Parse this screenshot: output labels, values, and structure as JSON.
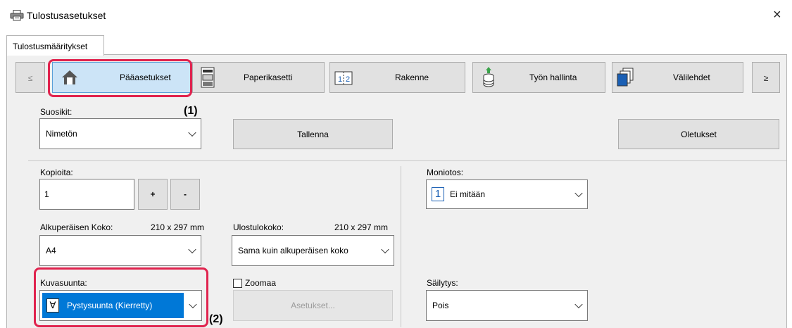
{
  "window": {
    "title": "Tulostusasetukset",
    "close_glyph": "×"
  },
  "tab": {
    "label": "Tulostusmääritykset"
  },
  "nav": {
    "prev_label": "≤",
    "next_label": "≥",
    "items": [
      {
        "label": "Pääasetukset",
        "icon": "home-icon"
      },
      {
        "label": "Paperikasetti",
        "icon": "paper-tray-icon"
      },
      {
        "label": "Rakenne",
        "icon": "layout-icon"
      },
      {
        "label": "Työn hallinta",
        "icon": "job-storage-icon"
      },
      {
        "label": "Välilehdet",
        "icon": "tab-pages-icon"
      }
    ]
  },
  "callouts": {
    "one": "(1)",
    "two": "(2)"
  },
  "favorites": {
    "label": "Suosikit:",
    "value": "Nimetön",
    "save_label": "Tallenna",
    "defaults_label": "Oletukset"
  },
  "copies": {
    "label": "Kopioita:",
    "value": "1",
    "plus_label": "+",
    "minus_label": "-"
  },
  "original_size": {
    "label": "Alkuperäisen Koko:",
    "dimensions": "210 x 297 mm",
    "value": "A4"
  },
  "output_size": {
    "label": "Ulostulokoko:",
    "dimensions": "210 x 297 mm",
    "value": "Sama kuin alkuperäisen koko"
  },
  "orientation": {
    "label": "Kuvasuunta:",
    "value": "Pystysuunta (Kierretty)",
    "icon_glyph": "∀"
  },
  "zoom": {
    "label": "Zoomaa",
    "settings_label": "Asetukset..."
  },
  "nup": {
    "label": "Moniotos:",
    "value": "Ei mitään",
    "icon_glyph": "1"
  },
  "retention": {
    "label": "Säilytys:",
    "value": "Pois"
  },
  "colors": {
    "highlight": "#e0234e",
    "selection": "#0078d7",
    "active_nav": "#cce4f7"
  }
}
